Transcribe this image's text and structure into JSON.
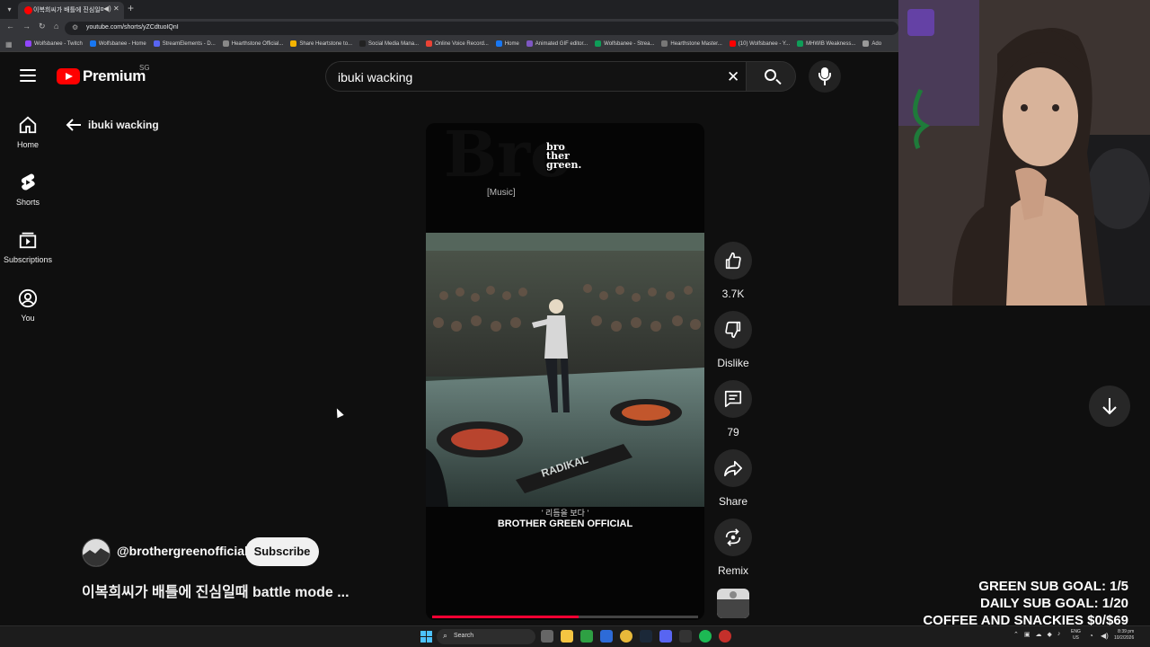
{
  "browser": {
    "tab_title": "이복희씨가 배틀에 진심일때",
    "tab_audio_icon": "speaker-icon",
    "url": "youtube.com/shorts/yZCdtuoIQnI",
    "bookmarks": [
      {
        "label": "Wolfsbanee - Twitch",
        "color": "#9146ff"
      },
      {
        "label": "Wolfsbanee - Home",
        "color": "#1877f2"
      },
      {
        "label": "StreamElements - D...",
        "color": "#5865f2"
      },
      {
        "label": "Hearthstone Official...",
        "color": "#888888"
      },
      {
        "label": "Share Heartstone to...",
        "color": "#f4b400"
      },
      {
        "label": "Social Media Mana...",
        "color": "#222222"
      },
      {
        "label": "Online Voice Record...",
        "color": "#ea4335"
      },
      {
        "label": "Home",
        "color": "#1877f2"
      },
      {
        "label": "Animated GIF editor...",
        "color": "#7e57c2"
      },
      {
        "label": "Wolfsbanee - Strea...",
        "color": "#0f9d58"
      },
      {
        "label": "Hearthstone Master...",
        "color": "#777777"
      },
      {
        "label": "(10) Wolfsbanee - Y...",
        "color": "#ff0000"
      },
      {
        "label": "MHWIB Weakness...",
        "color": "#0f9d58"
      },
      {
        "label": "Ado",
        "color": "#999999"
      }
    ]
  },
  "header": {
    "logo_text": "Premium",
    "region": "SG",
    "search_value": "ibuki wacking"
  },
  "guide": {
    "items": [
      {
        "label": "Home",
        "icon": "home-icon"
      },
      {
        "label": "Shorts",
        "icon": "shorts-icon"
      },
      {
        "label": "Subscriptions",
        "icon": "subscriptions-icon"
      },
      {
        "label": "You",
        "icon": "account-icon"
      }
    ]
  },
  "back": {
    "label": "ibuki wacking"
  },
  "player": {
    "brand": "bro ther green.",
    "music_tag": "[Music]",
    "caption_small": "' 리듬을 보다 '",
    "caption_big": "BROTHER GREEN OFFICIAL",
    "progress": 0.55
  },
  "actions": {
    "like_count": "3.7K",
    "dislike_label": "Dislike",
    "comment_count": "79",
    "share_label": "Share",
    "remix_label": "Remix"
  },
  "channel": {
    "handle": "@brothergreenofficial",
    "subscribe_label": "Subscribe"
  },
  "video": {
    "title": "이복희씨가 배틀에 진심일때 battle mode ..."
  },
  "overlay": {
    "green_sub_goal": "GREEN SUB GOAL: 1/5",
    "daily_sub_goal": "DAILY SUB GOAL: 1/20",
    "coffee_goal": "COFFEE AND SNACKIES $0/$69"
  },
  "taskbar": {
    "search_label": "Search",
    "lang_line1": "ENG",
    "lang_line2": "US",
    "time": "8:39 pm",
    "date": "10/2/2026",
    "accent": "#4cc2ff"
  }
}
